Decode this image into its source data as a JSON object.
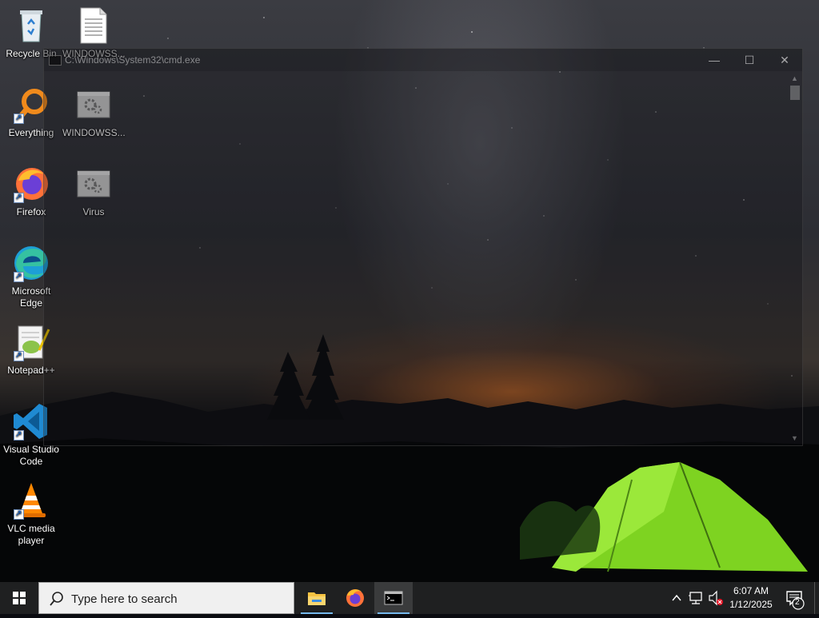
{
  "desktop": {
    "icons": [
      {
        "label": "Recycle Bin",
        "icon": "recycle-bin-icon"
      },
      {
        "label": "WINDOWSS...",
        "icon": "text-file-icon"
      },
      {
        "label": "Everything",
        "icon": "everything-search-icon"
      },
      {
        "label": "WINDOWSS...",
        "icon": "settings-file-icon"
      },
      {
        "label": "Firefox",
        "icon": "firefox-icon"
      },
      {
        "label": "Virus",
        "icon": "settings-file-icon"
      },
      {
        "label_line1": "Microsoft",
        "label_line2": "Edge",
        "icon": "edge-icon"
      },
      {
        "label": "Notepad++",
        "icon": "notepadpp-icon"
      },
      {
        "label_line1": "Visual Studio",
        "label_line2": "Code",
        "icon": "vscode-icon"
      },
      {
        "label_line1": "VLC media",
        "label_line2": "player",
        "icon": "vlc-icon"
      }
    ]
  },
  "cmd_window": {
    "title": "C:\\Windows\\System32\\cmd.exe",
    "minimize": "—",
    "maximize": "☐",
    "close": "✕"
  },
  "taskbar": {
    "search_placeholder": "Type here to search",
    "apps": [
      "file-explorer-icon",
      "firefox-icon",
      "cmd-icon"
    ],
    "active_app": "cmd-icon",
    "clock_time": "6:07 AM",
    "clock_date": "1/12/2025",
    "notification_count": "2",
    "accent": "#76b9ed"
  }
}
